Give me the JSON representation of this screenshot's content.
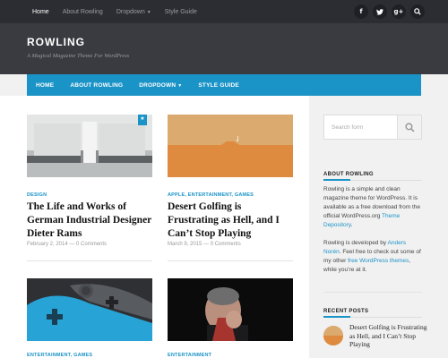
{
  "topbar": {
    "nav": [
      "Home",
      "About Rowling",
      "Dropdown",
      "Style Guide"
    ],
    "social_icons": [
      "facebook-icon",
      "twitter-icon",
      "google-plus-icon",
      "search-icon"
    ]
  },
  "header": {
    "title": "ROWLING",
    "tagline": "A Magical Magazine Theme For WordPress"
  },
  "mainnav": [
    "HOME",
    "ABOUT ROWLING",
    "DROPDOWN",
    "STYLE GUIDE"
  ],
  "posts": [
    {
      "category": "DESIGN",
      "title": "The Life and Works of German Industrial Designer Dieter Rams",
      "date": "February 2, 2014",
      "comments": "0 Comments",
      "sep": " — "
    },
    {
      "category": "APPLE, ENTERTAINMENT, GAMES",
      "title": "Desert Golfing is Frustrating as Hell, and I Can’t Stop Playing",
      "date": "March 9, 2015",
      "comments": "0 Comments",
      "sep": " — "
    },
    {
      "category": "ENTERTAINMENT, GAMES"
    },
    {
      "category": "ENTERTAINMENT"
    }
  ],
  "sidebar": {
    "search_placeholder": "Search form",
    "about_title": "ABOUT ROWLING",
    "about_p1": "Rowling is a simple and clean magazine theme for WordPress. It is available as a free download from the official WordPress.org ",
    "about_p1_link": "Theme Depository",
    "about_p1_end": ".",
    "about_p2_a": "Rowling is developed by ",
    "about_p2_link1": "Anders Norén",
    "about_p2_b": ". Feel free to check out some of my other ",
    "about_p2_link2": "free WordPress themes",
    "about_p2_c": ", while you’re at it.",
    "recent_title": "RECENT POSTS",
    "recent_post": "Desert Golfing is Frustrating as Hell, and I Can’t Stop Playing"
  },
  "colors": {
    "accent": "#1a93c7",
    "topbar": "#2c2d33",
    "header": "#3a3b41"
  }
}
